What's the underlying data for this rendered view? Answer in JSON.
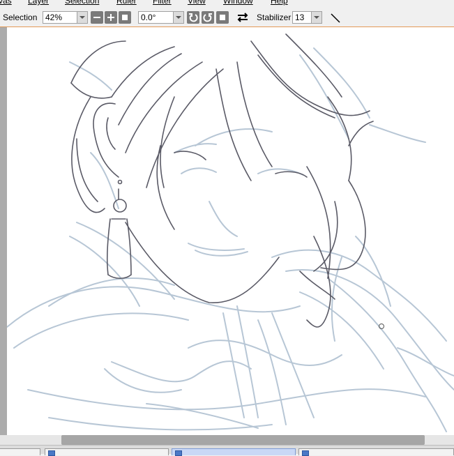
{
  "menubar": {
    "items": [
      "vas",
      "Layer",
      "Selection",
      "Ruler",
      "Filter",
      "View",
      "Window",
      "Help"
    ]
  },
  "toolbar": {
    "selection_label": "Selection",
    "zoom_value": "42%",
    "angle_value": "0.0°",
    "stabilizer_label": "Stabilizer",
    "stabilizer_value": "13"
  },
  "colors": {
    "accent_line": "#e39a55",
    "sketch_blue": "#9fb4c8",
    "lineart_dark": "#5a5a66"
  },
  "icons": [
    "zoom-out-icon",
    "zoom-in-icon",
    "zoom-reset-icon",
    "rotate-left-icon",
    "rotate-right-icon",
    "rotate-reset-icon",
    "flip-horizontal-icon",
    "stabilizer-dropdown-icon",
    "pen-line-icon"
  ],
  "tabs": [
    {
      "label": ""
    },
    {
      "label": ""
    },
    {
      "label": ""
    },
    {
      "label": ""
    }
  ]
}
